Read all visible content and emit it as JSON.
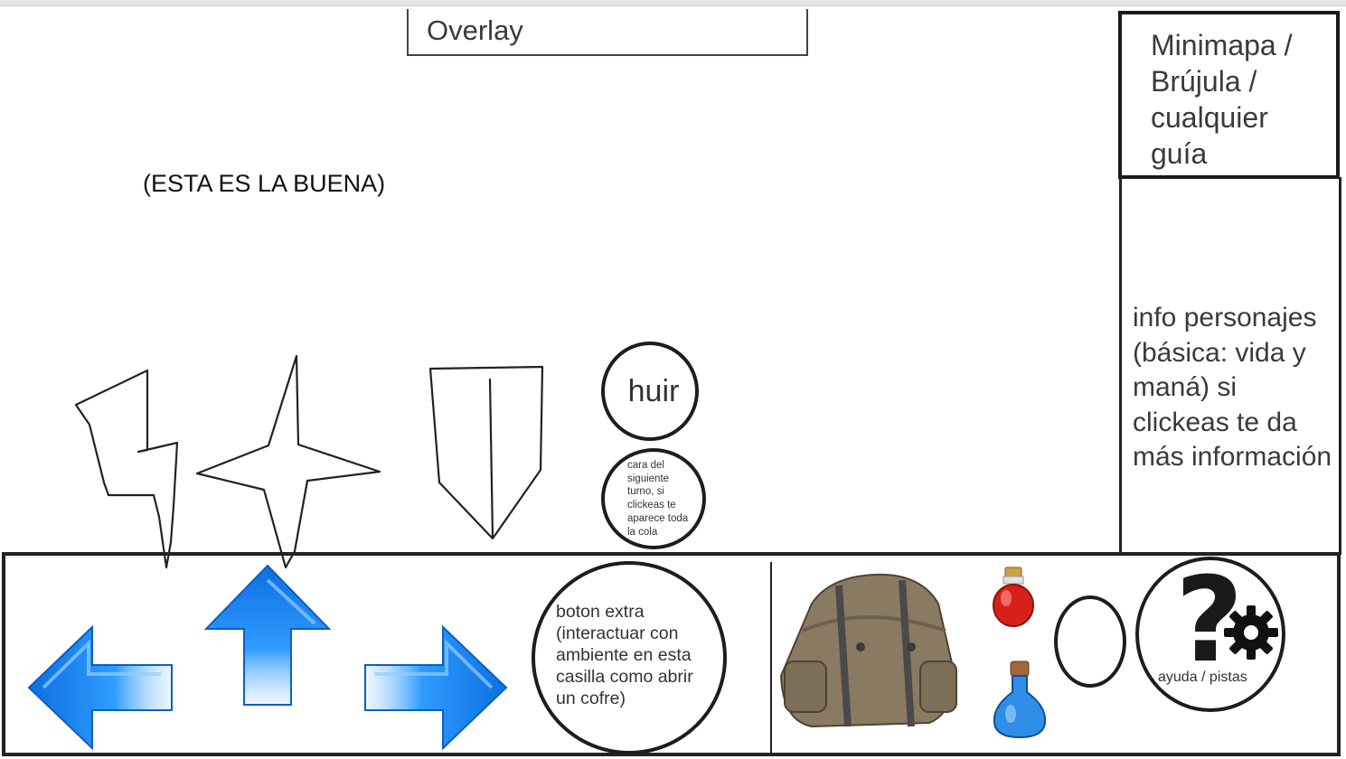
{
  "overlay": {
    "label": "Overlay"
  },
  "marker": {
    "text": "(ESTA ES LA BUENA)"
  },
  "minimap": {
    "text": "Minimapa / Brújula / cualquier guía"
  },
  "info_panel": {
    "text": "info personajes (básica: vida y maná) si clickeas te da más información"
  },
  "actions": {
    "flee_label": "huir",
    "next_turn_text": "cara del siguiente turno, si clickeas te aparece toda la cola"
  },
  "extra_button": {
    "text": "boton extra (interactuar con ambiente en esta casilla como abrir un cofre)"
  },
  "help": {
    "label": "ayuda / pistas",
    "symbol": "?"
  },
  "icons": {
    "attack": "lightning-icon",
    "magic": "star-icon",
    "defend": "shield-icon",
    "move_left": "arrow-left-icon",
    "move_forward": "arrow-up-icon",
    "move_right": "arrow-right-icon",
    "inventory": "backpack-icon",
    "health_potion": "red-potion-icon",
    "mana_potion": "blue-potion-icon",
    "settings": "gear-icon"
  },
  "colors": {
    "arrow_blue": "#1e90ff",
    "health_red": "#d8201a",
    "mana_blue": "#2f8ee6",
    "backpack_brown": "#8a7a62"
  }
}
